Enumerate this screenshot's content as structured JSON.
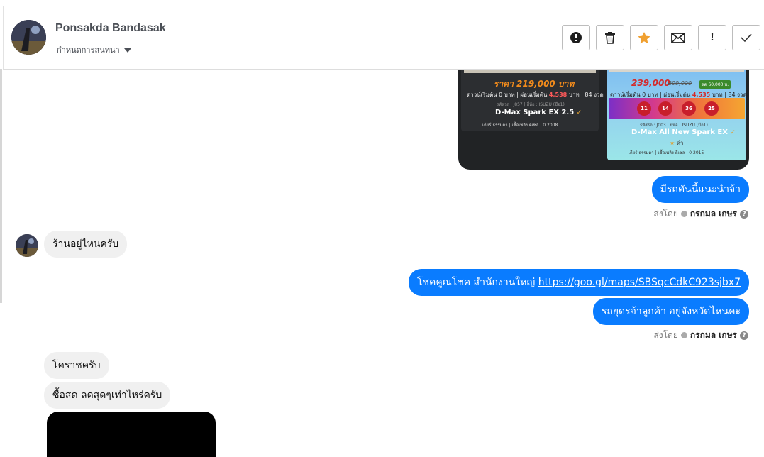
{
  "header": {
    "name": "Ponsakda Bandasak",
    "subtitle": "กำหนดการสนทนา",
    "actions": [
      {
        "name": "spam-button",
        "icon": "alert-circle-icon"
      },
      {
        "name": "delete-button",
        "icon": "trash-icon"
      },
      {
        "name": "star-button",
        "icon": "star-icon",
        "color": "#f0a030"
      },
      {
        "name": "email-button",
        "icon": "envelope-icon"
      },
      {
        "name": "important-button",
        "icon": "exclamation-icon",
        "label": "!"
      },
      {
        "name": "done-button",
        "icon": "check-icon"
      }
    ]
  },
  "attachment": {
    "left": {
      "price": "ราคา 219,000 บาท",
      "terms_a": "ดาวน์เริ่มต้น 0 บาท | ผ่อนเริ่มต้น",
      "terms_amount": "4,538",
      "terms_b": "บาท | 84 งวด",
      "meta": "รหัสรถ : J857 | ยี่ห้อ : ISUZU (มือ1)",
      "model": "D-Max Spark EX 2.5",
      "specs": "เกียร์ ธรรมดา | เชื้อเพลิง ดีเซล | 0 2008"
    },
    "right": {
      "price_new": "239,000",
      "price_old": "299,000",
      "badge": "ลด 60,000 บ.",
      "terms_a": "ดาวน์เริ่มต้น 0 บาท | ผ่อนเริ่มต้น",
      "terms_amount": "4,535",
      "terms_b": "บาท | 84 งวด",
      "dates": [
        "11",
        "14",
        "36",
        "25"
      ],
      "meta": "รหัสรถ : J003 | ยี่ห้อ : ISUZU (มือ1)",
      "model": "D-Max All New Spark EX",
      "sub": "ดำ",
      "specs": "เกียร์ ธรรมดา | เชื้อเพลิง ดีเซล | 0 2015"
    }
  },
  "messages": [
    {
      "id": "m1",
      "dir": "out",
      "text": "มีรถคันนี้แนะนำจ้า"
    },
    {
      "id": "m2",
      "dir": "in",
      "text": "ร้านอยู่ไหนครับ"
    },
    {
      "id": "m3",
      "dir": "out",
      "text": "โชคคูณโชค สำนักงานใหญ่",
      "link": "https://goo.gl/maps/SBSqcCdkC923sjbx7"
    },
    {
      "id": "m4",
      "dir": "out",
      "text": "รถยุดรจ้าลูกค้า อยู่จังหวัดไหนคะ"
    },
    {
      "id": "m5",
      "dir": "in",
      "text": "โคราชครับ"
    },
    {
      "id": "m6",
      "dir": "in",
      "text": "ซื้อสด ลดสุดๆเท่าไหร่ครับ"
    }
  ],
  "sent_by": {
    "prefix": "ส่งโดย",
    "agent": "กรกมล เกษร"
  }
}
